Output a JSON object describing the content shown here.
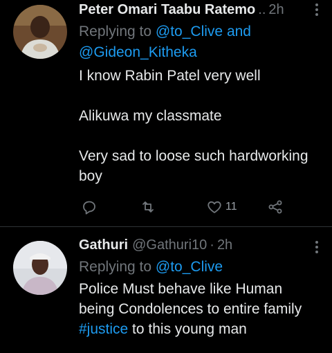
{
  "tweets": [
    {
      "name": "Peter Omari Taabu Ratemo",
      "handle_trunc": "..",
      "time": "2h",
      "reply_prefix": "Replying to",
      "mentions": [
        "@to_Clive",
        "and",
        "@Gideon_Kitheka"
      ],
      "lines": [
        "I know Rabin Patel very well",
        "Alikuwa my classmate",
        "Very sad to loose such hardworking",
        "boy"
      ],
      "likes": "11"
    },
    {
      "name": "Gathuri",
      "handle": "@Gathuri10",
      "time": "2h",
      "reply_prefix": "Replying to",
      "mention": "@to_Clive",
      "lines": [
        "Police Must behave like Human",
        "being Condolences to entire family"
      ],
      "hashtag": "#justice",
      "after_hashtag": " to this young man"
    }
  ],
  "colors": {
    "background": "#000000",
    "text": "#e7e9ea",
    "muted": "#71767b",
    "link": "#1d9bf0"
  },
  "icons": [
    "reply-icon",
    "retweet-icon",
    "like-icon",
    "share-icon",
    "more-icon"
  ]
}
